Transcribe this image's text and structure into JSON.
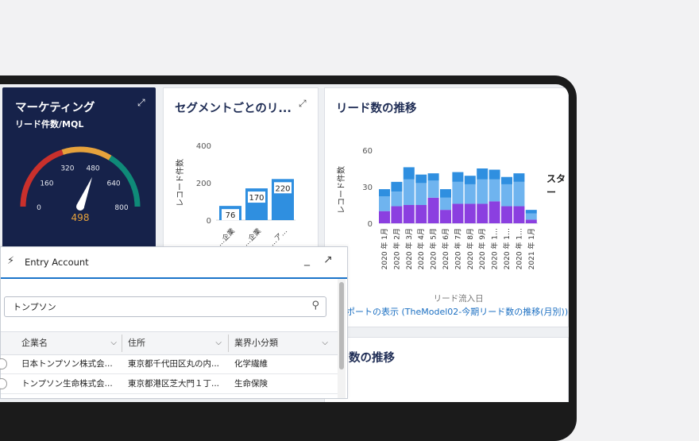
{
  "gauge": {
    "title": "マーケティング",
    "subtitle": "リード件数/MQL",
    "value": "498",
    "value_num": 498,
    "max": 800,
    "ticks": [
      "0",
      "160",
      "320",
      "480",
      "640",
      "800"
    ],
    "colors": {
      "low": "#c9302c",
      "mid": "#e6a23c",
      "high": "#0f8a78",
      "bg": "#16224a"
    }
  },
  "segment": {
    "title": "セグメントごとのリ...",
    "chart_data": {
      "type": "bar",
      "ylabel": "レコード件数",
      "ylim": [
        0,
        400
      ],
      "yticks": [
        "400",
        "200",
        "0"
      ],
      "categories": [
        "…企業",
        "…企業",
        "…ア…"
      ],
      "values": [
        76,
        170,
        220
      ],
      "color": "#2f8fe0"
    }
  },
  "trend": {
    "title": "リード数の推移",
    "chart_data": {
      "type": "bar",
      "stacked": true,
      "ylabel": "レコード件数",
      "xlabel": "リード流入日",
      "ylim": [
        0,
        60
      ],
      "yticks": [
        "60",
        "30",
        "0"
      ],
      "categories": [
        "2020 年 1月",
        "2020 年 2月",
        "2020 年 3月",
        "2020 年 4月",
        "2020 年 5月",
        "2020 年 6月",
        "2020 年 7月",
        "2020 年 8月",
        "2020 年 9月",
        "2020 年 1…",
        "2020 年 1…",
        "2020 年 1…",
        "2021 年 1月"
      ],
      "series": [
        {
          "values": [
            10,
            14,
            15,
            15,
            21,
            11,
            16,
            16,
            16,
            18,
            14,
            14,
            3
          ],
          "color": "#8b3fe0"
        },
        {
          "values": [
            12,
            12,
            21,
            18,
            14,
            10,
            18,
            16,
            20,
            18,
            18,
            20,
            5
          ],
          "color": "#6fb4ef"
        },
        {
          "values": [
            6,
            8,
            10,
            7,
            6,
            7,
            8,
            7,
            9,
            8,
            6,
            7,
            3
          ],
          "color": "#2f8fe0"
        }
      ]
    },
    "report_link": "ポートの表示 (TheModel02-今期リード数の推移(月別))"
  },
  "bottom_card": {
    "title": "数の推移"
  },
  "stray_text": "スター",
  "overlay": {
    "title": "Entry Account",
    "minimize": "_",
    "popout": "↗",
    "search": {
      "value": "トンプソン"
    },
    "columns": [
      "企業名",
      "住所",
      "業界小分類"
    ],
    "rows": [
      {
        "company": "日本トンプソン株式会...",
        "address": "東京都千代田区丸の内...",
        "industry": "化学繊維"
      },
      {
        "company": "トンプソン生命株式会...",
        "address": "東京都港区芝大門１丁...",
        "industry": "生命保険"
      }
    ]
  }
}
